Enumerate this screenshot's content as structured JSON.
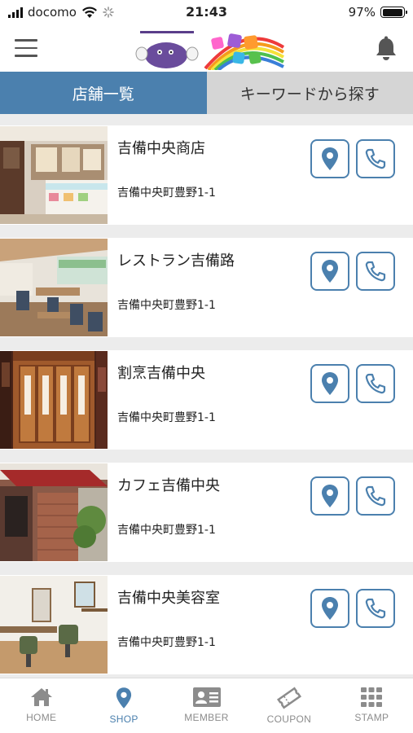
{
  "status_bar": {
    "carrier": "docomo",
    "time": "21:43",
    "battery": "97%",
    "battery_level": 0.97
  },
  "header": {
    "menu_icon": "hamburger-icon",
    "notification_icon": "bell-icon"
  },
  "tabs": [
    {
      "label": "店舗一覧",
      "active": true
    },
    {
      "label": "キーワードから探す",
      "active": false
    }
  ],
  "shops": [
    {
      "name": "吉備中央商店",
      "address": "吉備中央町豊野1-1",
      "photo": "shop-interior"
    },
    {
      "name": "レストラン吉備路",
      "address": "吉備中央町豊野1-1",
      "photo": "restaurant-interior"
    },
    {
      "name": "割烹吉備中央",
      "address": "吉備中央町豊野1-1",
      "photo": "wooden-doors"
    },
    {
      "name": "カフェ吉備中央",
      "address": "吉備中央町豊野1-1",
      "photo": "cafe-exterior"
    },
    {
      "name": "吉備中央美容室",
      "address": "吉備中央町豊野1-1",
      "photo": "salon-interior"
    }
  ],
  "bottom_nav": [
    {
      "label": "HOME",
      "icon": "home-icon",
      "active": false
    },
    {
      "label": "SHOP",
      "icon": "map-pin-icon",
      "active": true
    },
    {
      "label": "MEMBER",
      "icon": "member-card-icon",
      "active": false
    },
    {
      "label": "COUPON",
      "icon": "coupon-icon",
      "active": false
    },
    {
      "label": "STAMP",
      "icon": "grid-icon",
      "active": false
    }
  ],
  "colors": {
    "accent": "#4b80ae",
    "inactive_tab": "#d5d5d5",
    "nav_inactive": "#8c8c8c"
  }
}
